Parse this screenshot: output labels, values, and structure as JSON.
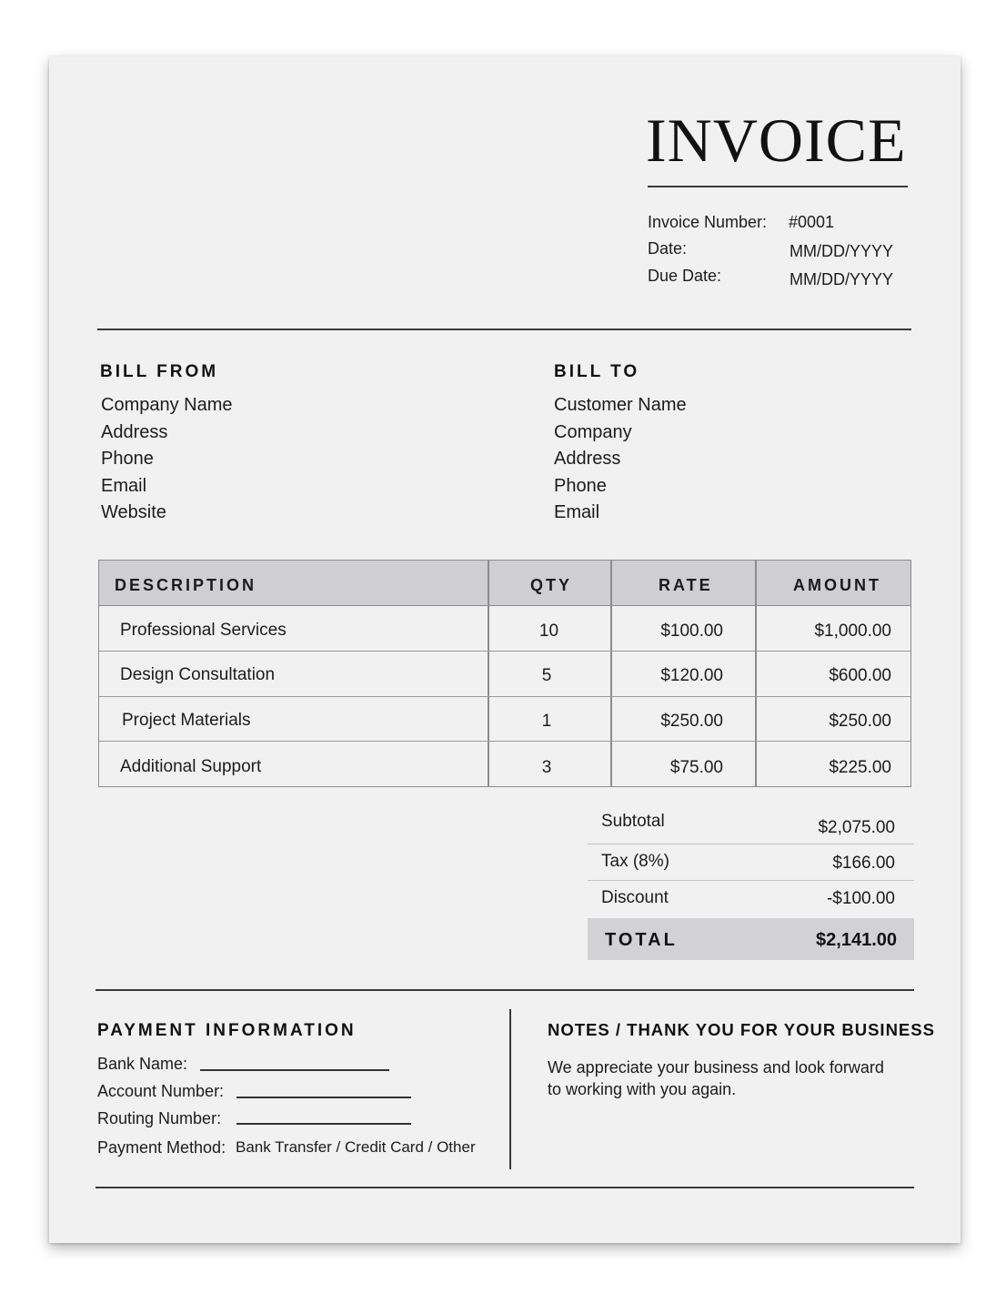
{
  "header": {
    "title": "INVOICE",
    "meta": [
      {
        "label": "Invoice Number:",
        "value": "#0001"
      },
      {
        "label": "Date:",
        "value": "MM/DD/YYYY"
      },
      {
        "label": "Due Date:",
        "value": "MM/DD/YYYY"
      }
    ]
  },
  "bill_from": {
    "heading": "BILL FROM",
    "lines": [
      "Company Name",
      "Address",
      "Phone",
      "Email",
      "Website"
    ]
  },
  "bill_to": {
    "heading": "BILL TO",
    "lines": [
      "Customer Name",
      "Company",
      "Address",
      "Phone",
      "Email"
    ]
  },
  "items": {
    "columns": [
      "DESCRIPTION",
      "QTY",
      "RATE",
      "AMOUNT"
    ],
    "rows": [
      {
        "description": "Professional Services",
        "qty": "10",
        "rate": "$100.00",
        "amount": "$1,000.00"
      },
      {
        "description": "Design Consultation",
        "qty": "5",
        "rate": "$120.00",
        "amount": "$600.00"
      },
      {
        "description": "Project Materials",
        "qty": "1",
        "rate": "$250.00",
        "amount": "$250.00"
      },
      {
        "description": "Additional Support",
        "qty": "3",
        "rate": "$75.00",
        "amount": "$225.00"
      }
    ]
  },
  "totals": {
    "rows": [
      {
        "label": "Subtotal",
        "value": "$2,075.00"
      },
      {
        "label": "Tax (8%)",
        "value": "$166.00"
      },
      {
        "label": "Discount",
        "value": "-$100.00"
      }
    ],
    "total_label": "TOTAL",
    "total_value": "$2,141.00"
  },
  "payment": {
    "heading": "PAYMENT INFORMATION",
    "fields": [
      "Bank Name:",
      "Account Number:",
      "Routing Number:"
    ],
    "method_label": "Payment Method:",
    "method_options": "Bank Transfer / Credit Card / Other"
  },
  "notes": {
    "heading": "NOTES / THANK YOU FOR YOUR BUSINESS",
    "lines": [
      "We appreciate your business and look forward",
      "to working with you again."
    ]
  }
}
